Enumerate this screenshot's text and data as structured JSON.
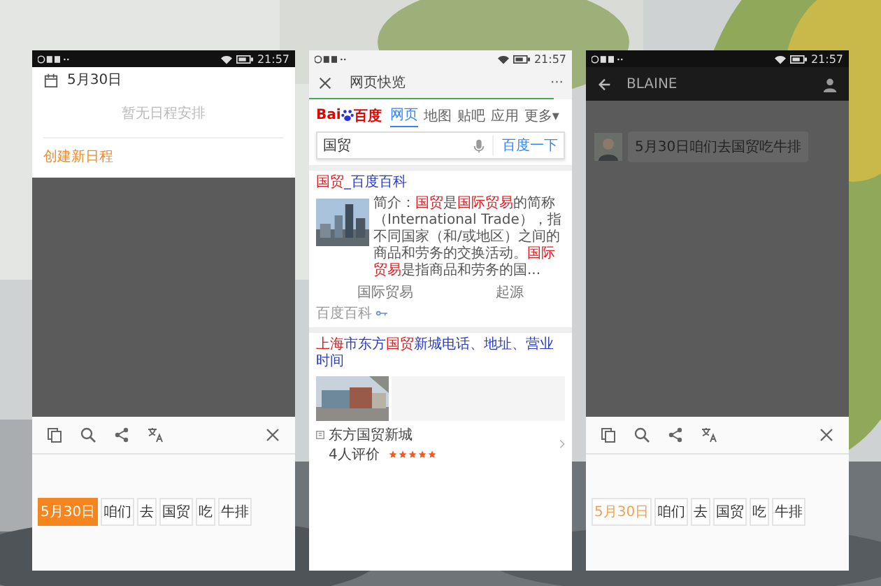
{
  "phones": [
    {
      "kind": "calendar",
      "status_time": "21:57",
      "date": "5月30日",
      "empty_text": "暂无日程安排",
      "create_link": "创建新日程",
      "tokens": [
        {
          "text": "5月30日",
          "selected": true
        },
        {
          "text": "咱们",
          "selected": false
        },
        {
          "text": "去",
          "selected": false
        },
        {
          "text": "国贸",
          "selected": false
        },
        {
          "text": "吃",
          "selected": false
        },
        {
          "text": "牛排",
          "selected": false
        }
      ]
    },
    {
      "kind": "browser",
      "status_time": "21:57",
      "title": "网页快览",
      "more": "···",
      "progress": {
        "level": 0.93
      },
      "logo": {
        "latin": "Bai",
        "cjk": "百度"
      },
      "tabs": [
        {
          "label": "网页",
          "selected": true
        },
        {
          "label": "地图",
          "selected": false
        },
        {
          "label": "贴吧",
          "selected": false
        },
        {
          "label": "应用",
          "selected": false
        },
        {
          "label": "更多▾",
          "selected": false
        }
      ],
      "search": {
        "value": "国贸",
        "button": "百度一下"
      },
      "result_1": {
        "title": [
          {
            "text": "国贸",
            "hl": true
          },
          {
            "text": "_百度百科",
            "hl": false
          }
        ],
        "snippet": [
          {
            "text": "简介：",
            "hl": false
          },
          {
            "text": "国贸",
            "hl": true
          },
          {
            "text": "是",
            "hl": false
          },
          {
            "text": "国际贸易",
            "hl": true
          },
          {
            "text": "的简称（International Trade），指不同国家（和/或地区）之间的商品和劳务的交换活动。",
            "hl": false
          },
          {
            "text": "国际贸易",
            "hl": true
          },
          {
            "text": "是指商品和劳务的国...",
            "hl": false
          }
        ],
        "links": [
          "国际贸易",
          "起源"
        ],
        "source": "百度百科"
      },
      "result_2": {
        "title": [
          {
            "text": "上海",
            "hl": true
          },
          {
            "text": "市东方",
            "hl": false
          },
          {
            "text": "国贸",
            "hl": true
          },
          {
            "text": "新城电话、地址、营业时间",
            "hl": false
          }
        ],
        "place": "东方国贸新城",
        "reviews": "4人评价",
        "stars": 5
      }
    },
    {
      "kind": "chat",
      "status_time": "21:57",
      "contact": "BLAINE",
      "message": "5月30日咱们去国贸吃牛排",
      "tokens": [
        {
          "text": "5月30日",
          "selected": true
        },
        {
          "text": "咱们",
          "selected": false
        },
        {
          "text": "去",
          "selected": false
        },
        {
          "text": "国贸",
          "selected": false
        },
        {
          "text": "吃",
          "selected": false
        },
        {
          "text": "牛排",
          "selected": false
        }
      ]
    }
  ]
}
